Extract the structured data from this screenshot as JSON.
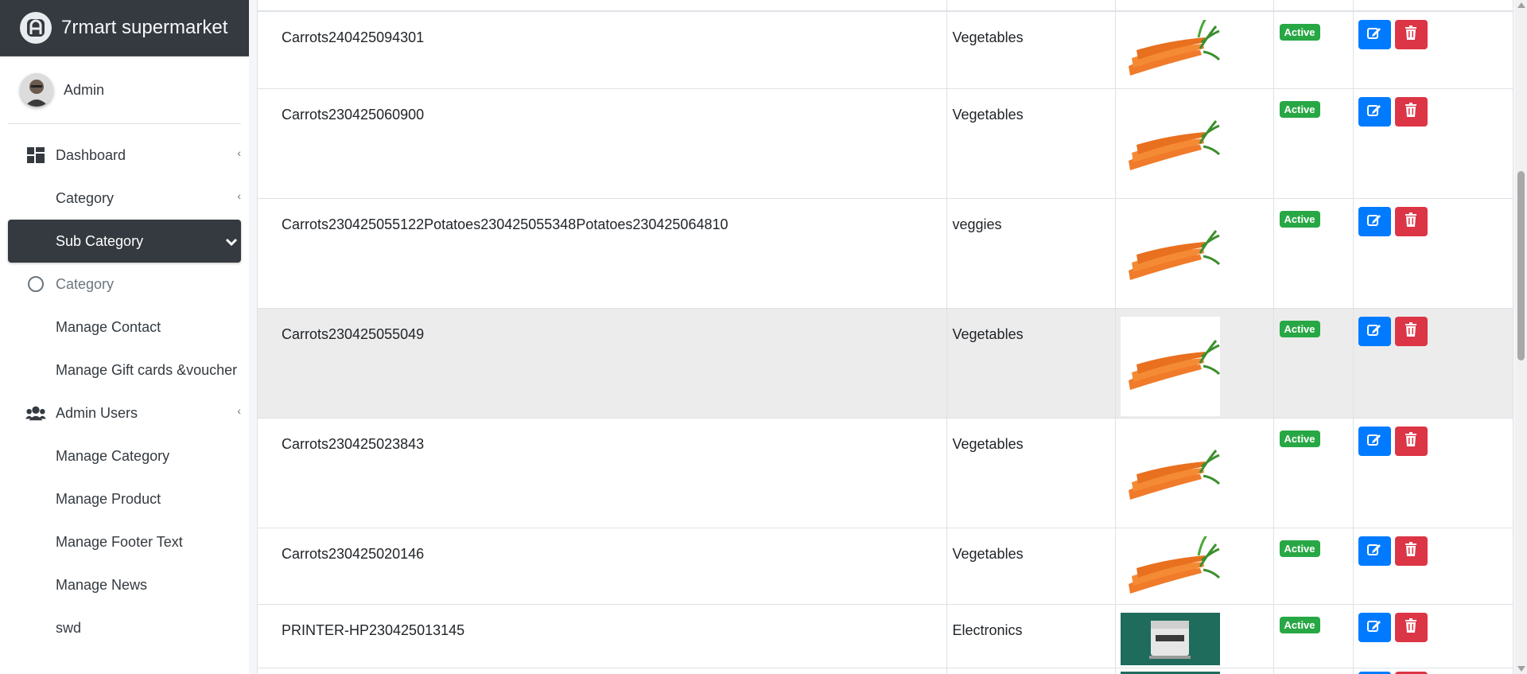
{
  "brand": {
    "title": "7rmart supermarket"
  },
  "user": {
    "name": "Admin"
  },
  "sidebar": {
    "items": [
      {
        "label": "Dashboard",
        "icon": "dashboard-icon",
        "caret": "‹"
      },
      {
        "label": "Category",
        "caret": "‹"
      },
      {
        "label": "Sub Category",
        "active": true
      },
      {
        "label": "Category",
        "icon": "circle-icon"
      },
      {
        "label": "Manage Contact"
      },
      {
        "label": "Manage Gift cards &voucher"
      },
      {
        "label": "Admin Users",
        "icon": "users-icon",
        "caret": "‹"
      },
      {
        "label": "Manage Category"
      },
      {
        "label": "Manage Product"
      },
      {
        "label": "Manage Footer Text"
      },
      {
        "label": "Manage News"
      },
      {
        "label": "swd"
      }
    ]
  },
  "table": {
    "rows": [
      {
        "name": "Carrots240425094301",
        "category": "Vegetables",
        "status": "Active",
        "image": "carrot-image"
      },
      {
        "name": "Carrots230425060900",
        "category": "Vegetables",
        "status": "Active",
        "image": "carrot-image"
      },
      {
        "name": "Carrots230425055122Potatoes230425055348Potatoes230425064810",
        "category": "veggies",
        "status": "Active",
        "image": "carrot-image"
      },
      {
        "name": "Carrots230425055049",
        "category": "Vegetables",
        "status": "Active",
        "image": "carrot-image"
      },
      {
        "name": "Carrots230425023843",
        "category": "Vegetables",
        "status": "Active",
        "image": "carrot-image"
      },
      {
        "name": "Carrots230425020146",
        "category": "Vegetables",
        "status": "Active",
        "image": "carrot-image"
      },
      {
        "name": "PRINTER-HP230425013145",
        "category": "Electronics",
        "status": "Active",
        "image": "printer-image"
      }
    ]
  },
  "colors": {
    "accent": "#343a40",
    "active_badge": "#28a745",
    "edit": "#007bff",
    "delete": "#dc3545"
  }
}
